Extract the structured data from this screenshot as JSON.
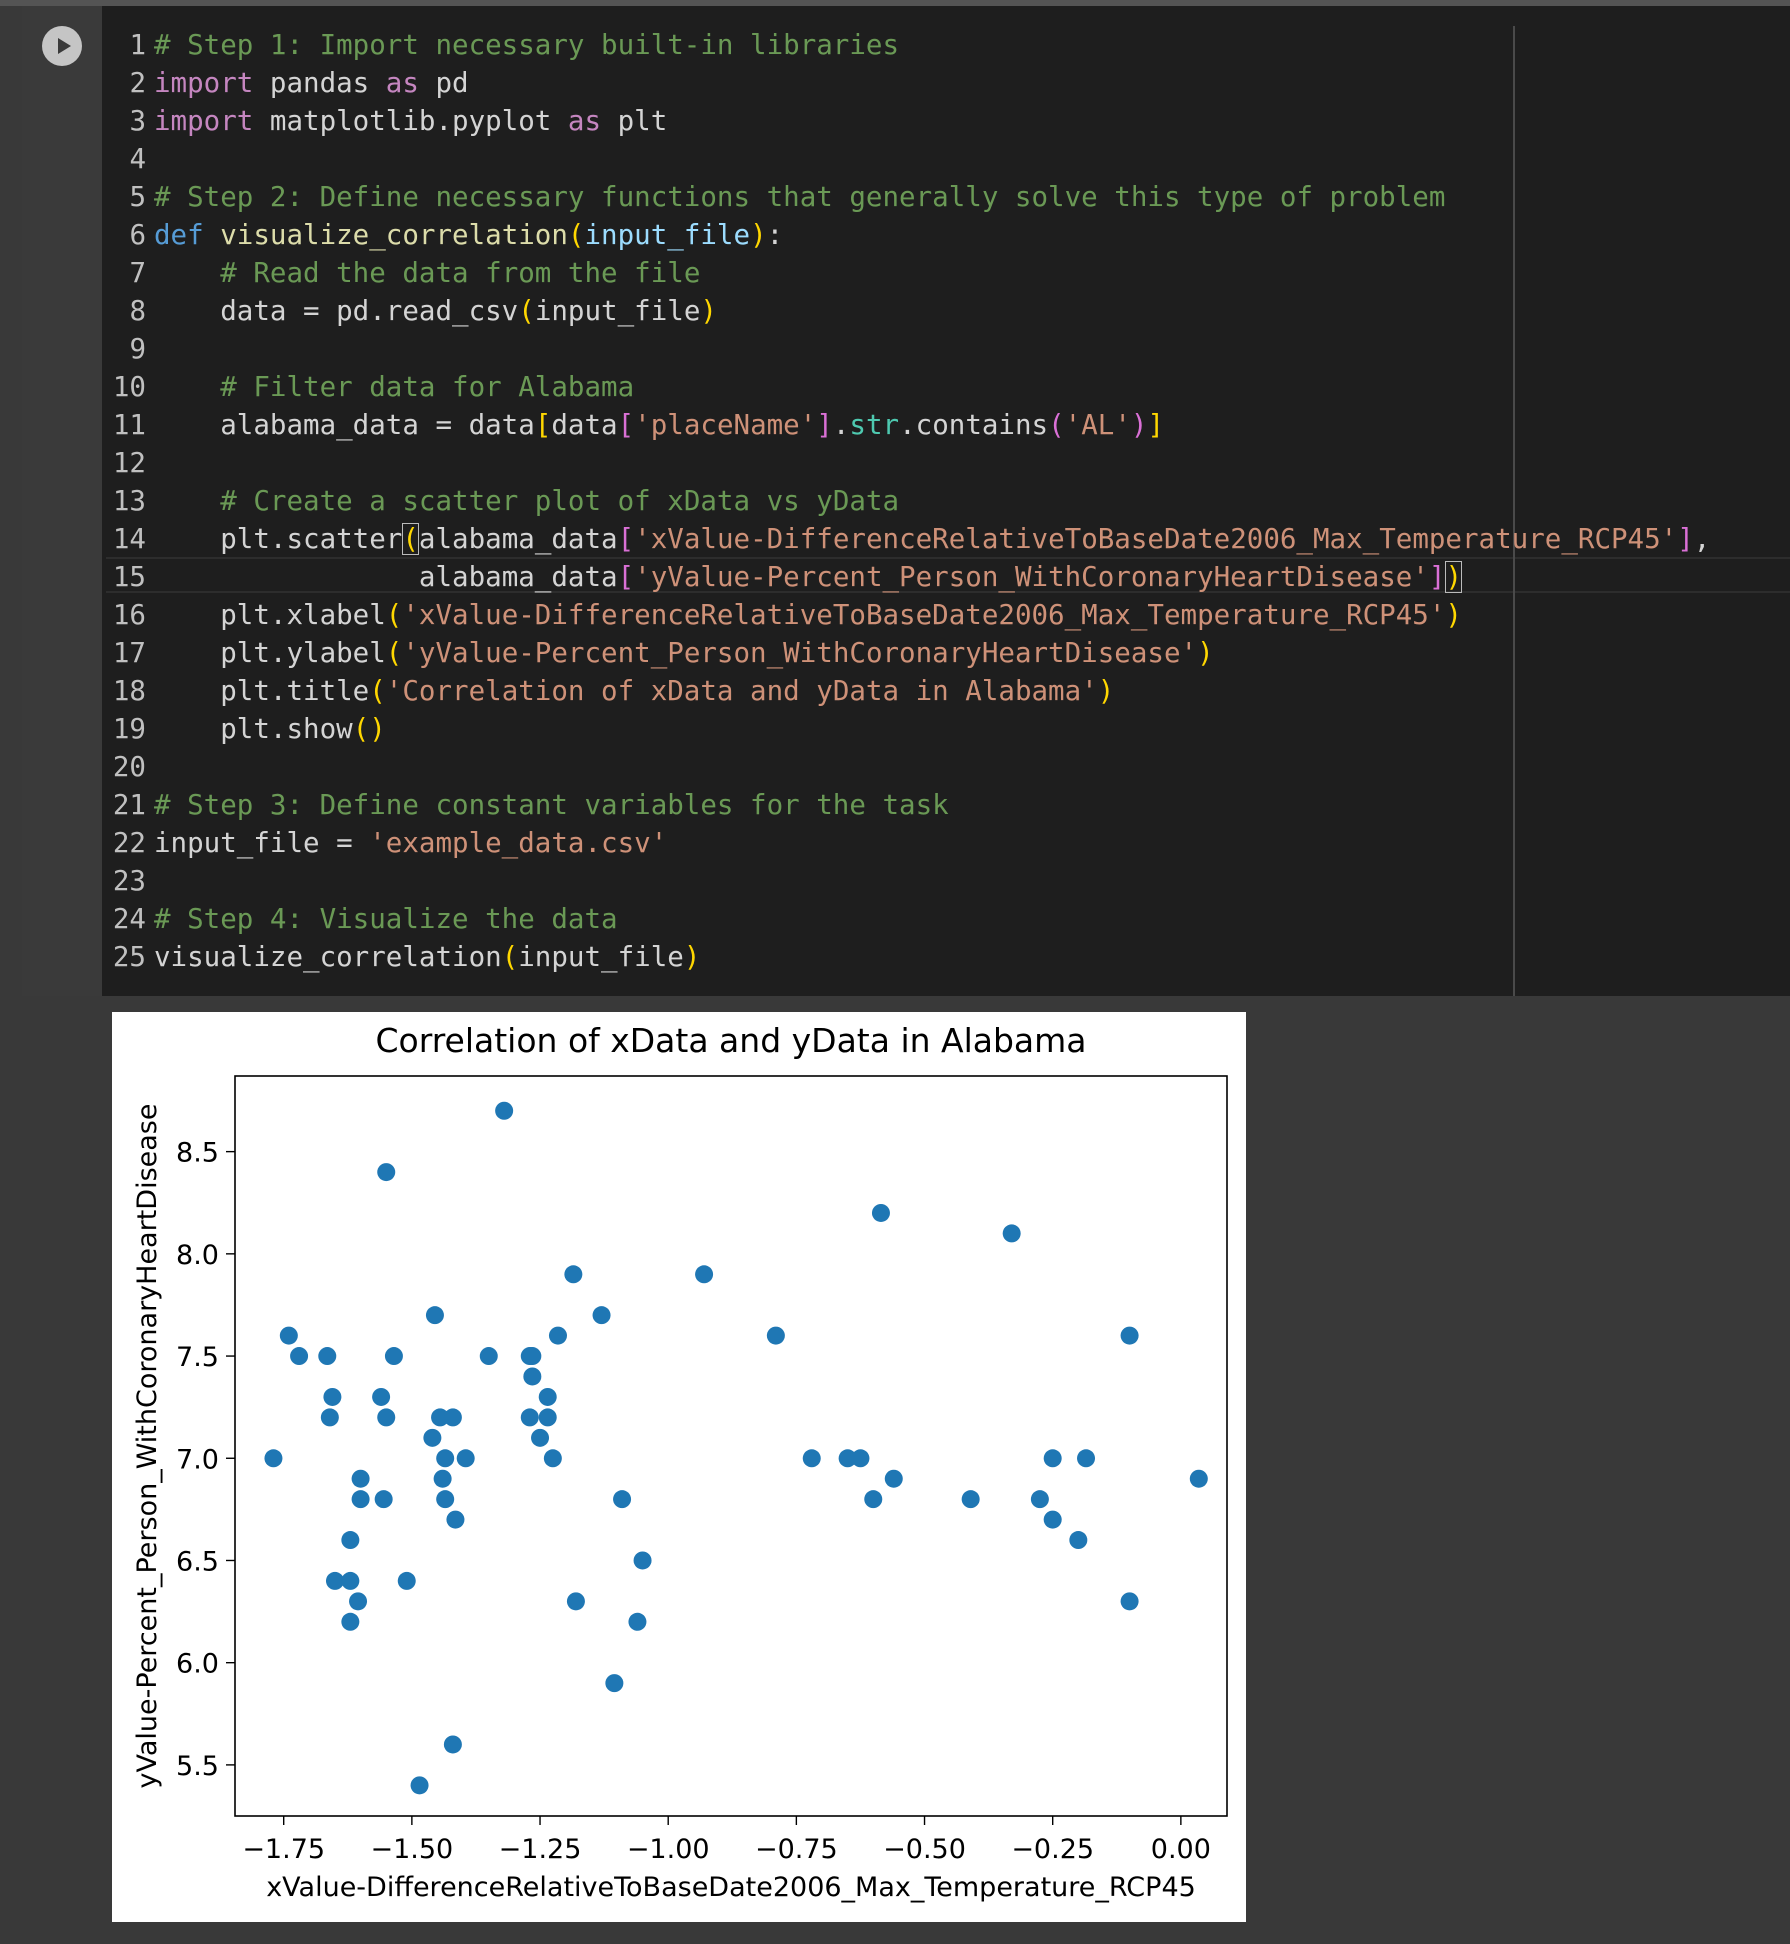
{
  "run_button": {
    "icon": "play-icon"
  },
  "code": {
    "lines": [
      {
        "n": "1",
        "tokens": [
          {
            "t": "# Step 1: Import necessary built-in libraries",
            "c": "cm"
          }
        ]
      },
      {
        "n": "2",
        "tokens": [
          {
            "t": "import",
            "c": "kw"
          },
          {
            "t": " pandas "
          },
          {
            "t": "as",
            "c": "kw"
          },
          {
            "t": " pd"
          }
        ]
      },
      {
        "n": "3",
        "tokens": [
          {
            "t": "import",
            "c": "kw"
          },
          {
            "t": " matplotlib.pyplot "
          },
          {
            "t": "as",
            "c": "kw"
          },
          {
            "t": " plt"
          }
        ]
      },
      {
        "n": "4",
        "tokens": []
      },
      {
        "n": "5",
        "tokens": [
          {
            "t": "# Step 2: Define necessary functions that generally solve this type of problem",
            "c": "cm"
          }
        ]
      },
      {
        "n": "6",
        "tokens": [
          {
            "t": "def",
            "c": "def"
          },
          {
            "t": " "
          },
          {
            "t": "visualize_correlation",
            "c": "fn"
          },
          {
            "t": "(",
            "c": "b1"
          },
          {
            "t": "input_file",
            "c": "prm"
          },
          {
            "t": ")",
            "c": "b1"
          },
          {
            "t": ":"
          }
        ]
      },
      {
        "n": "7",
        "tokens": [
          {
            "t": "    "
          },
          {
            "t": "# Read the data from the file",
            "c": "cm"
          }
        ]
      },
      {
        "n": "8",
        "tokens": [
          {
            "t": "    data = pd.read_csv"
          },
          {
            "t": "(",
            "c": "b1"
          },
          {
            "t": "input_file"
          },
          {
            "t": ")",
            "c": "b1"
          }
        ]
      },
      {
        "n": "9",
        "tokens": []
      },
      {
        "n": "10",
        "tokens": [
          {
            "t": "    "
          },
          {
            "t": "# Filter data for Alabama",
            "c": "cm"
          }
        ]
      },
      {
        "n": "11",
        "tokens": [
          {
            "t": "    alabama_data = data"
          },
          {
            "t": "[",
            "c": "b1"
          },
          {
            "t": "data"
          },
          {
            "t": "[",
            "c": "b2"
          },
          {
            "t": "'placeName'",
            "c": "str"
          },
          {
            "t": "]",
            "c": "b2"
          },
          {
            "t": "."
          },
          {
            "t": "str",
            "c": "bt"
          },
          {
            "t": ".contains"
          },
          {
            "t": "(",
            "c": "b2"
          },
          {
            "t": "'AL'",
            "c": "str"
          },
          {
            "t": ")",
            "c": "b2"
          },
          {
            "t": "]",
            "c": "b1"
          }
        ]
      },
      {
        "n": "12",
        "tokens": []
      },
      {
        "n": "13",
        "tokens": [
          {
            "t": "    "
          },
          {
            "t": "# Create a scatter plot of xData vs yData",
            "c": "cm"
          }
        ]
      },
      {
        "n": "14",
        "tokens": [
          {
            "t": "    plt.scatter"
          },
          {
            "t": "(",
            "c": "b1 cursor"
          },
          {
            "t": "alabama_data"
          },
          {
            "t": "[",
            "c": "b2"
          },
          {
            "t": "'xValue-DifferenceRelativeToBaseDate2006_Max_Temperature_RCP45'",
            "c": "str"
          },
          {
            "t": "]",
            "c": "b2"
          },
          {
            "t": ","
          }
        ]
      },
      {
        "n": "15",
        "tokens": [
          {
            "t": "                "
          },
          {
            "t": "alabama_data"
          },
          {
            "t": "[",
            "c": "b2"
          },
          {
            "t": "'yValue-Percent_Person_WithCoronaryHeartDisease'",
            "c": "str"
          },
          {
            "t": "]",
            "c": "b2"
          },
          {
            "t": ")",
            "c": "b1 cursor"
          }
        ]
      },
      {
        "n": "16",
        "tokens": [
          {
            "t": "    plt.xlabel"
          },
          {
            "t": "(",
            "c": "b1"
          },
          {
            "t": "'xValue-DifferenceRelativeToBaseDate2006_Max_Temperature_RCP45'",
            "c": "str"
          },
          {
            "t": ")",
            "c": "b1"
          }
        ]
      },
      {
        "n": "17",
        "tokens": [
          {
            "t": "    plt.ylabel"
          },
          {
            "t": "(",
            "c": "b1"
          },
          {
            "t": "'yValue-Percent_Person_WithCoronaryHeartDisease'",
            "c": "str"
          },
          {
            "t": ")",
            "c": "b1"
          }
        ]
      },
      {
        "n": "18",
        "tokens": [
          {
            "t": "    plt.title"
          },
          {
            "t": "(",
            "c": "b1"
          },
          {
            "t": "'Correlation of xData and yData in Alabama'",
            "c": "str"
          },
          {
            "t": ")",
            "c": "b1"
          }
        ]
      },
      {
        "n": "19",
        "tokens": [
          {
            "t": "    plt.show"
          },
          {
            "t": "()",
            "c": "b1"
          }
        ]
      },
      {
        "n": "20",
        "tokens": []
      },
      {
        "n": "21",
        "tokens": [
          {
            "t": "# Step 3: Define constant variables for the task",
            "c": "cm"
          }
        ]
      },
      {
        "n": "22",
        "tokens": [
          {
            "t": "input_file = "
          },
          {
            "t": "'example_data.csv'",
            "c": "str"
          }
        ]
      },
      {
        "n": "23",
        "tokens": []
      },
      {
        "n": "24",
        "tokens": [
          {
            "t": "# Step 4: Visualize the data",
            "c": "cm"
          }
        ]
      },
      {
        "n": "25",
        "tokens": [
          {
            "t": "visualize_correlation"
          },
          {
            "t": "(",
            "c": "b1"
          },
          {
            "t": "input_file"
          },
          {
            "t": ")",
            "c": "b1"
          }
        ]
      }
    ]
  },
  "chart_data": {
    "type": "scatter",
    "title": "Correlation of xData and yData in Alabama",
    "xlabel": "xValue-DifferenceRelativeToBaseDate2006_Max_Temperature_RCP45",
    "ylabel": "yValue-Percent_Person_WithCoronaryHeartDisease",
    "xlim": [
      -1.845,
      0.09
    ],
    "ylim": [
      5.25,
      8.87
    ],
    "xticks": [
      -1.75,
      -1.5,
      -1.25,
      -1.0,
      -0.75,
      -0.5,
      -0.25,
      0.0
    ],
    "xtick_labels": [
      "−1.75",
      "−1.50",
      "−1.25",
      "−1.00",
      "−0.75",
      "−0.50",
      "−0.25",
      "0.00"
    ],
    "yticks": [
      5.5,
      6.0,
      6.5,
      7.0,
      7.5,
      8.0,
      8.5
    ],
    "ytick_labels": [
      "5.5",
      "6.0",
      "6.5",
      "7.0",
      "7.5",
      "8.0",
      "8.5"
    ],
    "marker_color": "#1f77b4",
    "grid": false,
    "points": [
      [
        -1.77,
        7.0
      ],
      [
        -1.74,
        7.6
      ],
      [
        -1.72,
        7.5
      ],
      [
        -1.665,
        7.5
      ],
      [
        -1.655,
        7.3
      ],
      [
        -1.66,
        7.2
      ],
      [
        -1.65,
        6.4
      ],
      [
        -1.62,
        6.4
      ],
      [
        -1.62,
        6.6
      ],
      [
        -1.62,
        6.2
      ],
      [
        -1.6,
        6.9
      ],
      [
        -1.6,
        6.8
      ],
      [
        -1.605,
        6.3
      ],
      [
        -1.56,
        7.3
      ],
      [
        -1.55,
        8.4
      ],
      [
        -1.55,
        7.2
      ],
      [
        -1.555,
        6.8
      ],
      [
        -1.535,
        7.5
      ],
      [
        -1.51,
        6.4
      ],
      [
        -1.485,
        5.4
      ],
      [
        -1.46,
        7.1
      ],
      [
        -1.455,
        7.7
      ],
      [
        -1.445,
        7.2
      ],
      [
        -1.44,
        6.9
      ],
      [
        -1.435,
        7.0
      ],
      [
        -1.435,
        6.8
      ],
      [
        -1.42,
        7.2
      ],
      [
        -1.42,
        5.6
      ],
      [
        -1.415,
        6.7
      ],
      [
        -1.395,
        7.0
      ],
      [
        -1.35,
        7.5
      ],
      [
        -1.32,
        8.7
      ],
      [
        -1.27,
        7.5
      ],
      [
        -1.265,
        7.4
      ],
      [
        -1.265,
        7.5
      ],
      [
        -1.27,
        7.2
      ],
      [
        -1.25,
        7.1
      ],
      [
        -1.235,
        7.2
      ],
      [
        -1.235,
        7.3
      ],
      [
        -1.225,
        7.0
      ],
      [
        -1.215,
        7.6
      ],
      [
        -1.185,
        7.9
      ],
      [
        -1.18,
        6.3
      ],
      [
        -1.13,
        7.7
      ],
      [
        -1.105,
        5.9
      ],
      [
        -1.09,
        6.8
      ],
      [
        -1.06,
        6.2
      ],
      [
        -1.05,
        6.5
      ],
      [
        -0.93,
        7.9
      ],
      [
        -0.79,
        7.6
      ],
      [
        -0.72,
        7.0
      ],
      [
        -0.65,
        7.0
      ],
      [
        -0.625,
        7.0
      ],
      [
        -0.6,
        6.8
      ],
      [
        -0.585,
        8.2
      ],
      [
        -0.56,
        6.9
      ],
      [
        -0.41,
        6.8
      ],
      [
        -0.33,
        8.1
      ],
      [
        -0.275,
        6.8
      ],
      [
        -0.25,
        6.7
      ],
      [
        -0.25,
        7.0
      ],
      [
        -0.2,
        6.6
      ],
      [
        -0.185,
        7.0
      ],
      [
        -0.1,
        7.6
      ],
      [
        -0.1,
        6.3
      ],
      [
        0.035,
        6.9
      ]
    ]
  }
}
